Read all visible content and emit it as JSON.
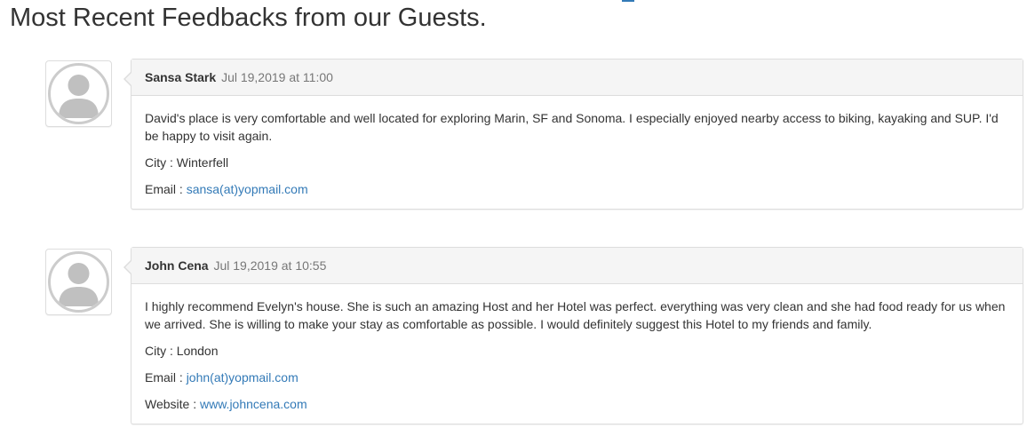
{
  "page": {
    "title": "Most Recent Feedbacks from our Guests."
  },
  "colors": {
    "link": "#337ab7",
    "panel_heading_bg": "#f5f5f5",
    "border": "#dddddd",
    "muted_text": "#777777"
  },
  "feedbacks": [
    {
      "avatar_icon": "user-avatar-placeholder-icon",
      "author": "Sansa Stark",
      "date": "Jul 19,2019 at 11:00",
      "message": "David's place is very comfortable and well located for exploring Marin, SF and Sonoma. I especially enjoyed nearby access to biking, kayaking and SUP. I'd be happy to visit again.",
      "city_label": "City : ",
      "city": "Winterfell",
      "email_label": "Email : ",
      "email": "sansa(at)yopmail.com"
    },
    {
      "avatar_icon": "user-avatar-placeholder-icon",
      "author": "John Cena",
      "date": "Jul 19,2019 at 10:55",
      "message": "I highly recommend Evelyn's house. She is such an amazing Host and her Hotel was perfect. everything was very clean and she had food ready for us when we arrived. She is willing to make your stay as comfortable as possible. I would definitely suggest this Hotel to my friends and family.",
      "city_label": "City : ",
      "city": "London",
      "email_label": "Email : ",
      "email": "john(at)yopmail.com",
      "website_label": "Website : ",
      "website": "www.johncena.com"
    }
  ]
}
